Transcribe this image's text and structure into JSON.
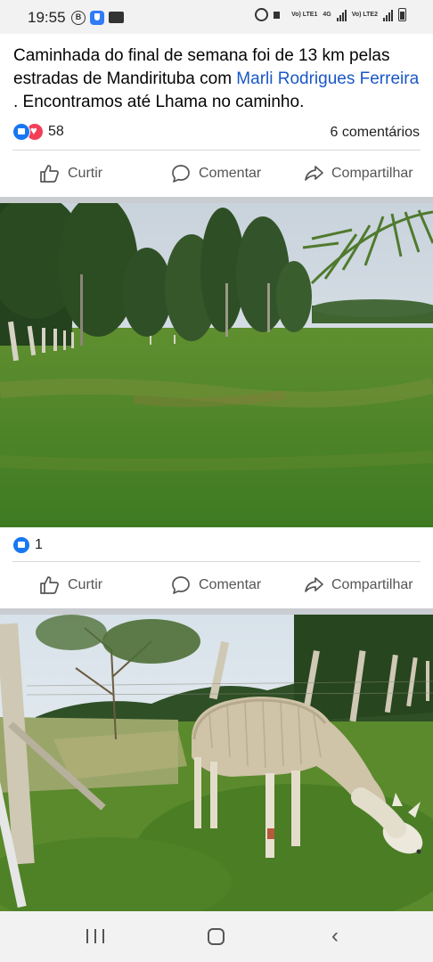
{
  "status_bar": {
    "time": "19:55",
    "b_icon": "B",
    "lte1": "Vo) LTE1",
    "lte2": "Vo) LTE2",
    "net": "4G"
  },
  "post": {
    "text_before": "Caminhada do final de semana foi de 13 km pelas estradas de Mandirituba com ",
    "mention": "Marli Rodrigues Ferreira",
    "text_after": " . Encontramos até Lhama no caminho.",
    "reaction_count": "58",
    "comments_label": "6 comentários"
  },
  "actions": {
    "like": "Curtir",
    "comment": "Comentar",
    "share": "Compartilhar"
  },
  "photo2": {
    "reaction_count": "1"
  },
  "icons": {
    "like": "thumbs-up-icon",
    "comment": "speech-bubble-icon",
    "share": "share-arrow-icon",
    "nav_recent": "recent-apps-icon",
    "nav_home": "home-icon",
    "nav_back": "back-icon"
  },
  "colors": {
    "link": "#1a57c7",
    "like_blue": "#1877f2",
    "love_red": "#f33e58",
    "gap_grey": "#c9ccd1"
  }
}
